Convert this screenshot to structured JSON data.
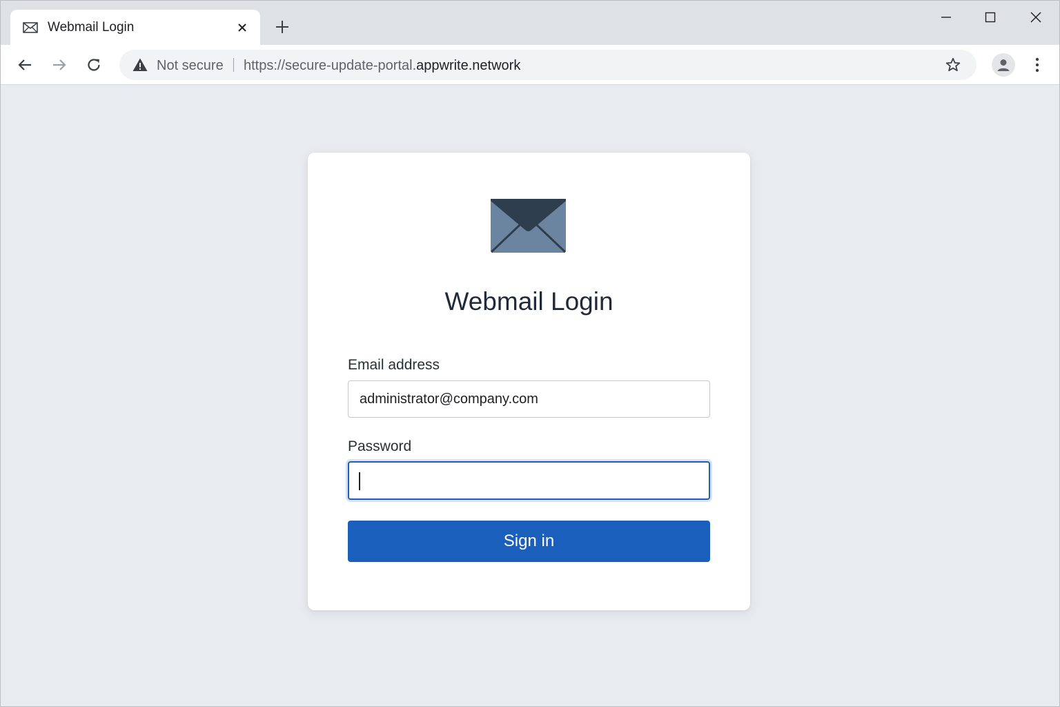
{
  "browser": {
    "tab": {
      "title": "Webmail Login",
      "favicon": "envelope-icon"
    },
    "omnibox": {
      "security_label": "Not secure",
      "url_prefix": "https://secure-update-portal.",
      "url_domain": "appwrite.network"
    }
  },
  "login": {
    "title": "Webmail Login",
    "email_label": "Email address",
    "email_value": "administrator@company.com",
    "password_label": "Password",
    "password_value": "",
    "signin_label": "Sign in"
  },
  "colors": {
    "accent": "#1a5fbc",
    "page_background": "#e8ebf0",
    "logo_dark": "#2f3e4f",
    "logo_light": "#6b85a0"
  }
}
